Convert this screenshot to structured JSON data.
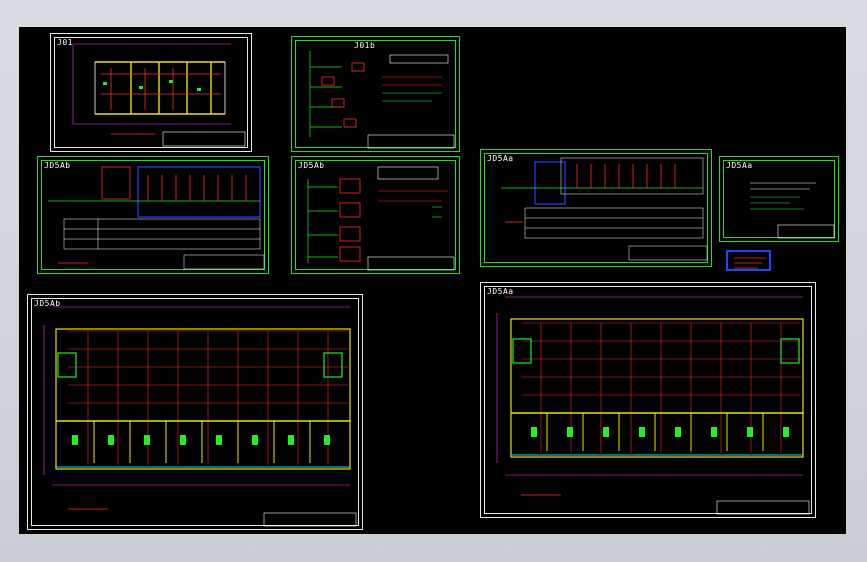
{
  "workspace": {
    "background": "#000000",
    "frame_color": "#c9ced6"
  },
  "colors": {
    "sheet_white": "#e8e8e8",
    "sheet_green": "#22dd22",
    "wire_red": "#ff2a2a",
    "wall_yellow": "#e6e600",
    "dim_magenta": "#ff33ff",
    "device_green": "#22ee22",
    "panel_blue": "#2244ff",
    "cyan": "#00e5e5"
  },
  "sheets": [
    {
      "id": "floor-plan-small",
      "title": "J01"
    },
    {
      "id": "system-diagram-1",
      "title": "J01b"
    },
    {
      "id": "distribution-panel-1",
      "title": "JD5Ab"
    },
    {
      "id": "system-diagram-2",
      "title": "JD5Ab"
    },
    {
      "id": "distribution-panel-2",
      "title": "JD5Aa"
    },
    {
      "id": "legend-sheet",
      "title": "JD5Aa"
    },
    {
      "id": "floor-plan-large-1",
      "title": "JD5Ab"
    },
    {
      "id": "floor-plan-large-2",
      "title": "JD5Aa"
    }
  ]
}
